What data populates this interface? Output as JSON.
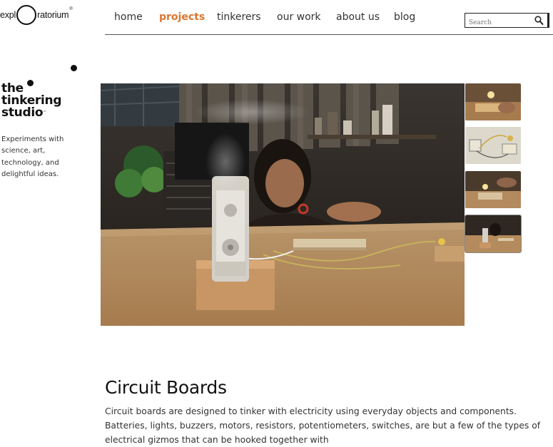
{
  "header": {
    "logo": {
      "left_text": "expl",
      "right_text": "ratorium",
      "mark": "®"
    },
    "nav": [
      {
        "label": "home",
        "active": false
      },
      {
        "label": "projects",
        "active": true
      },
      {
        "label": "tinkerers",
        "active": false
      },
      {
        "label": "our work",
        "active": false
      },
      {
        "label": "about us",
        "active": false
      },
      {
        "label": "blog",
        "active": false
      }
    ],
    "search": {
      "placeholder": "Search",
      "icon": "magnifier-icon"
    }
  },
  "sidebar": {
    "brand_lines": [
      "the",
      "tinkering",
      "studio"
    ],
    "brand_mark": "™",
    "tagline": "Experiments with science, art, technology, and delightful ideas."
  },
  "gallery": {
    "main_photo": "Woman at a workbench assembling a circuit board with a spinning motorized device",
    "thumbnails": [
      {
        "name": "thumbnail-lamp-circuit",
        "selected": false
      },
      {
        "name": "thumbnail-wire-circuit",
        "selected": false
      },
      {
        "name": "thumbnail-bulb-board",
        "selected": false
      },
      {
        "name": "thumbnail-workbench",
        "selected": true
      }
    ]
  },
  "article": {
    "title": "Circuit Boards",
    "body": "Circuit boards are designed to tinker with electricity using everyday objects and components. Batteries, lights, buzzers, motors, resistors, potentiometers, switches, are but a few of the types of electrical gizmos that can be hooked together with"
  },
  "colors": {
    "accent": "#d9762e",
    "text": "#222222",
    "background": "#ffffff"
  }
}
